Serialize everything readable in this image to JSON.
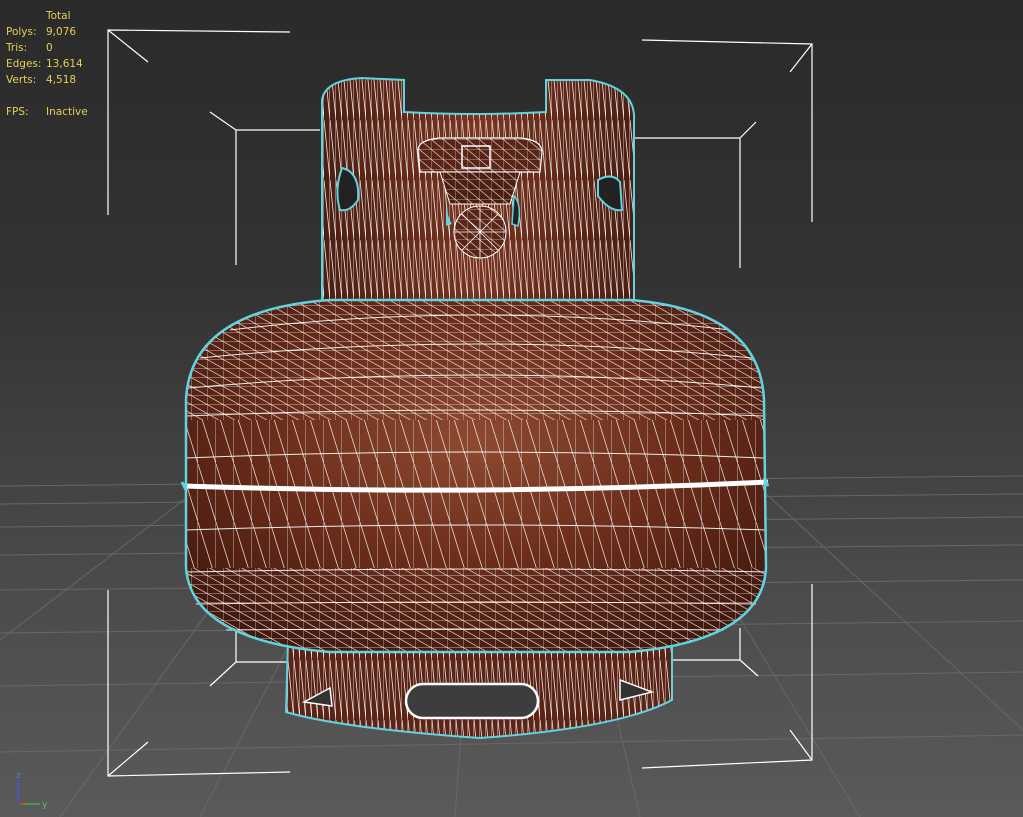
{
  "viewport": {
    "stats": {
      "header": "Total",
      "rows": [
        {
          "label": "Polys:",
          "value": "9,076"
        },
        {
          "label": "Tris:",
          "value": "0"
        },
        {
          "label": "Edges:",
          "value": "13,614"
        },
        {
          "label": "Verts:",
          "value": "4,518"
        }
      ],
      "fps": {
        "label": "FPS:",
        "value": "Inactive"
      }
    },
    "axis": {
      "z": "z",
      "y": "y"
    },
    "colors": {
      "selection": "#5fd3e0",
      "wire": "#ffffff",
      "material": "#6e2e1c",
      "stats_text": "#e6cf55"
    }
  }
}
